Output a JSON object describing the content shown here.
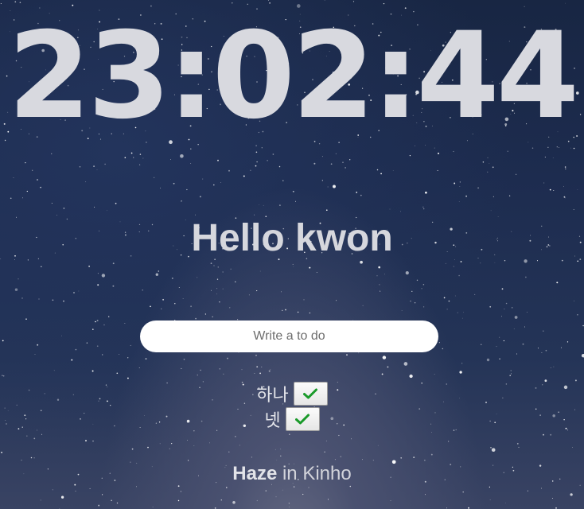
{
  "clock": {
    "time": "23:02:44"
  },
  "greeting": {
    "text": "Hello kwon"
  },
  "todo_form": {
    "placeholder": "Write a to do"
  },
  "todos": [
    {
      "text": "하나",
      "button_icon": "checkmark-icon"
    },
    {
      "text": "넷",
      "button_icon": "checkmark-icon"
    }
  ],
  "credit": {
    "author": "Haze",
    "connector": "in",
    "place": "Kinho"
  },
  "colors": {
    "checkmark": "#1a9a2a",
    "text": "#d8d9df",
    "input_bg": "#ffffff"
  }
}
